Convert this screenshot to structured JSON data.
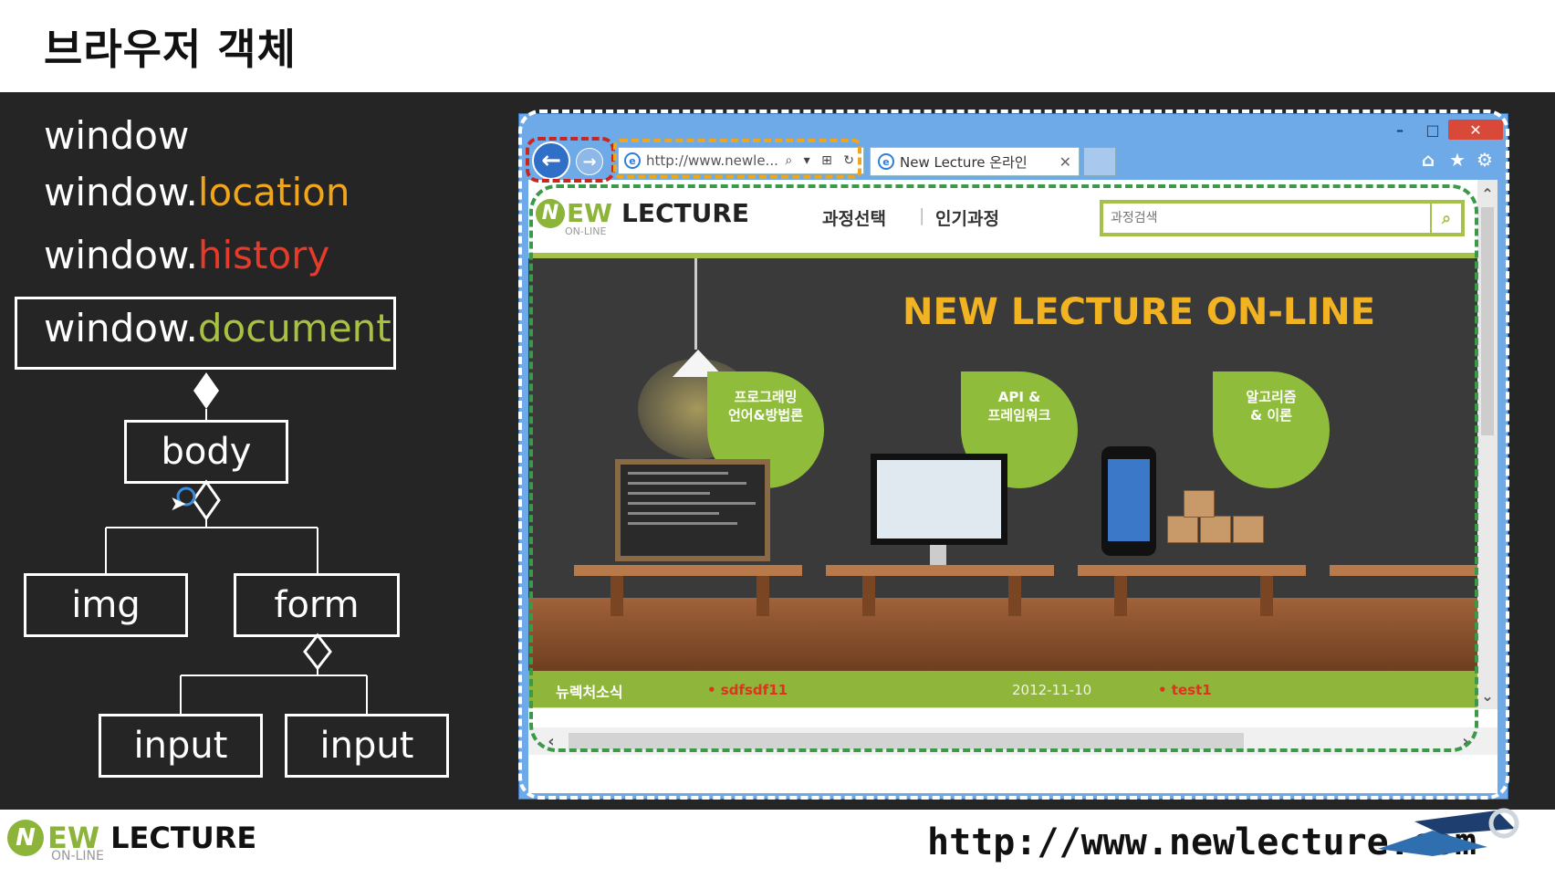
{
  "slide": {
    "title": "브라우저 객체"
  },
  "objects": {
    "line1": "window",
    "line2_prefix": "window.",
    "line2_prop": "location",
    "line3_prefix": "window.",
    "line3_prop": "history",
    "line4_prefix": "window.",
    "line4_prop": "document"
  },
  "tree": {
    "body": "body",
    "img": "img",
    "form": "form",
    "input1": "input",
    "input2": "input"
  },
  "browser": {
    "address_url": "http://www.newle...",
    "address_tools": "⌕ ▾ ⊞ ↻",
    "tab_title": "New Lecture 온라인",
    "tab_close": "✕",
    "back_icon": "←",
    "forward_icon": "→",
    "win_min": "–",
    "win_max": "□",
    "win_close": "✕",
    "home_icon": "⌂",
    "star_icon": "★",
    "gear_icon": "⚙"
  },
  "site": {
    "logo_n": "N",
    "logo_ew": "EW",
    "logo_lecture": "LECTURE",
    "logo_sub": "ON-LINE",
    "nav": [
      "과정선택",
      "인기과정"
    ],
    "search_placeholder": "과정검색",
    "search_icon": "⌕",
    "banner_title": "NEW LECTURE ON-LINE",
    "categories": [
      "프로그래밍\n언어&방법론",
      "API &\n프레임워크",
      "알고리즘\n& 이론"
    ],
    "footer": {
      "news_label": "뉴렉처소식",
      "post1": "• sdfsdf11",
      "date": "2012-11-10",
      "post2": "• test1"
    }
  },
  "scroll": {
    "up": "⌃",
    "down": "⌄",
    "left": "‹",
    "right": "›"
  },
  "footer": {
    "logo_n": "N",
    "logo_ew": "EW",
    "logo_lecture": "LECTURE",
    "logo_sub": "ON-LINE",
    "url": "http://www.newlecture.com"
  },
  "colors": {
    "location": "#f0a51a",
    "history": "#e63a2a",
    "document": "#a9c142",
    "brand_green": "#8cb33a",
    "banner_title": "#f2b323"
  }
}
